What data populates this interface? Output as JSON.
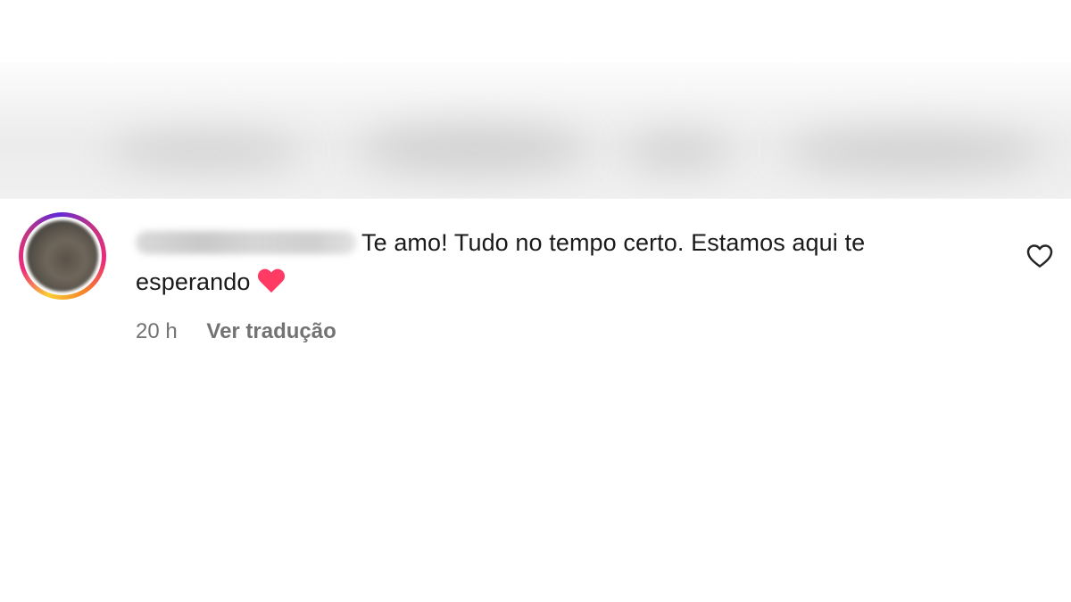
{
  "comment": {
    "text_line1": "Te amo! Tudo no tempo certo. Estamos aqui te",
    "text_line2": "esperando",
    "emoji": "heart-emoji",
    "timestamp": "20 h",
    "translate_label": "Ver tradução"
  },
  "icons": {
    "like": "heart-outline-icon",
    "reaction": "red-heart-emoji"
  },
  "colors": {
    "text": "#1a1a1a",
    "meta": "#737373",
    "heart_emoji": "#ff3b63",
    "story_ring_start": "#f9ce34",
    "story_ring_mid": "#ee2a7b",
    "story_ring_end": "#6228d7"
  }
}
